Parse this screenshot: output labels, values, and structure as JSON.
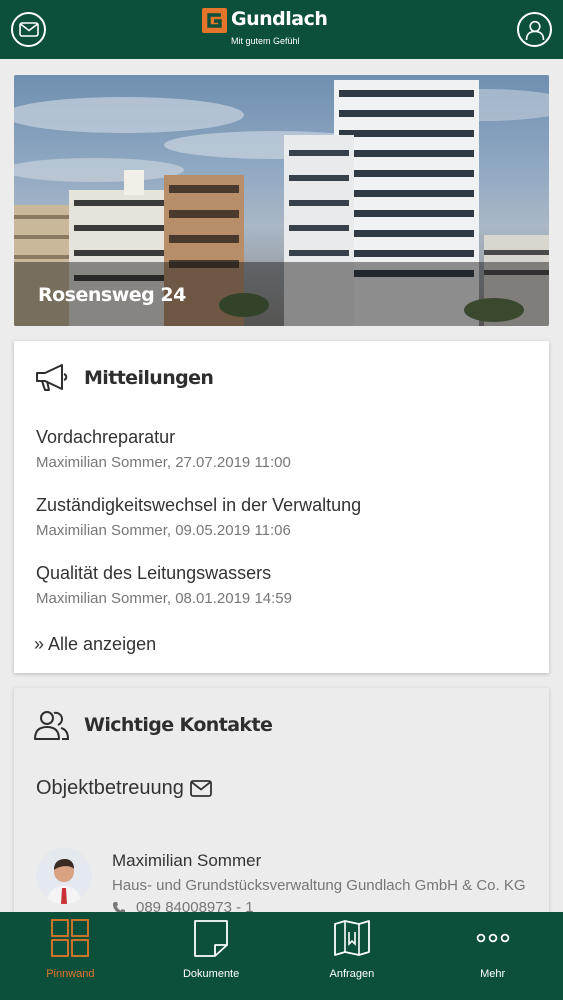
{
  "header": {
    "brand": "Gundlach",
    "tagline": "Mit gutem Gefühl",
    "colors": {
      "bar": "#0c4f3b",
      "accent": "#e4752a"
    }
  },
  "hero": {
    "title": "Rosensweg 24"
  },
  "news": {
    "heading": "Mitteilungen",
    "items": [
      {
        "title": "Vordachreparatur",
        "meta": "Maximilian Sommer, 27.07.2019 11:00"
      },
      {
        "title": "Zuständigkeitswechsel in der Verwaltung",
        "meta": "Maximilian Sommer, 09.05.2019 11:06"
      },
      {
        "title": "Qualität des Leitungswassers",
        "meta": "Maximilian Sommer, 08.01.2019 14:59"
      }
    ],
    "show_all": "» Alle anzeigen"
  },
  "contacts": {
    "heading": "Wichtige Kontakte",
    "group_label": "Objektbetreuung",
    "person": {
      "name": "Maximilian Sommer",
      "company": "Haus- und Grundstücksverwaltung Gundlach GmbH & Co. KG",
      "phone": "089 84008973 - 1"
    }
  },
  "tabs": [
    {
      "label": "Pinnwand",
      "icon": "grid-icon",
      "active": true
    },
    {
      "label": "Dokumente",
      "icon": "document-icon",
      "active": false
    },
    {
      "label": "Anfragen",
      "icon": "map-folder-icon",
      "active": false
    },
    {
      "label": "Mehr",
      "icon": "more-dots-icon",
      "active": false
    }
  ]
}
